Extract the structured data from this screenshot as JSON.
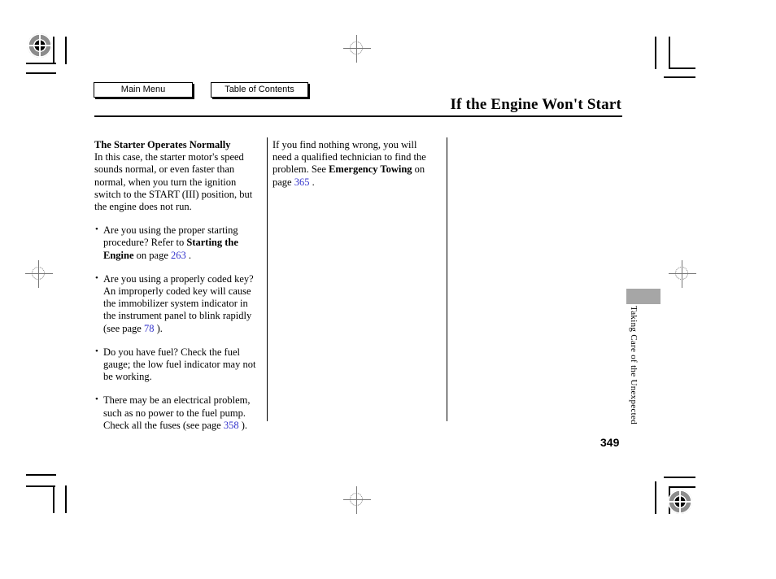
{
  "nav": {
    "main_menu_label": "Main Menu",
    "table_of_contents_label": "Table of Contents"
  },
  "header": {
    "title": "If the Engine Won't Start"
  },
  "left_column": {
    "subhead": "The Starter Operates Normally",
    "intro": "In this case, the starter motor's speed sounds normal, or even faster than normal, when you turn the ignition switch to the START (III) position, but the engine does not run.",
    "bullets": [
      {
        "text_before": "Are you using the proper starting procedure? Refer to ",
        "bold": "Starting the Engine",
        "text_mid": " on page ",
        "page": "263",
        "text_after": "."
      },
      {
        "text_before": "Are you using a properly coded key? An improperly coded key will cause the immobilizer system indicator in the instrument panel to blink rapidly (see page ",
        "bold": "",
        "text_mid": "",
        "page": "78",
        "text_after": ")."
      },
      {
        "text_before": "Do you have fuel? Check the fuel gauge; the low fuel indicator may not be working.",
        "bold": "",
        "text_mid": "",
        "page": "",
        "text_after": ""
      },
      {
        "text_before": "There may be an electrical problem, such as no power to the fuel pump. Check all the fuses (see page ",
        "bold": "",
        "text_mid": "",
        "page": "358",
        "text_after": ")."
      }
    ]
  },
  "middle_column": {
    "text_before": "If you find nothing wrong, you will need a qualified technician to find the problem. See ",
    "bold": "Emergency Towing",
    "text_mid": " on page ",
    "page": "365",
    "text_after": "."
  },
  "side_tab": {
    "label": "Taking Care of the Unexpected"
  },
  "folio": {
    "page_number": "349"
  },
  "colors": {
    "link": "#3333cc",
    "tab": "#a6a6a6",
    "rule": "#000000"
  }
}
